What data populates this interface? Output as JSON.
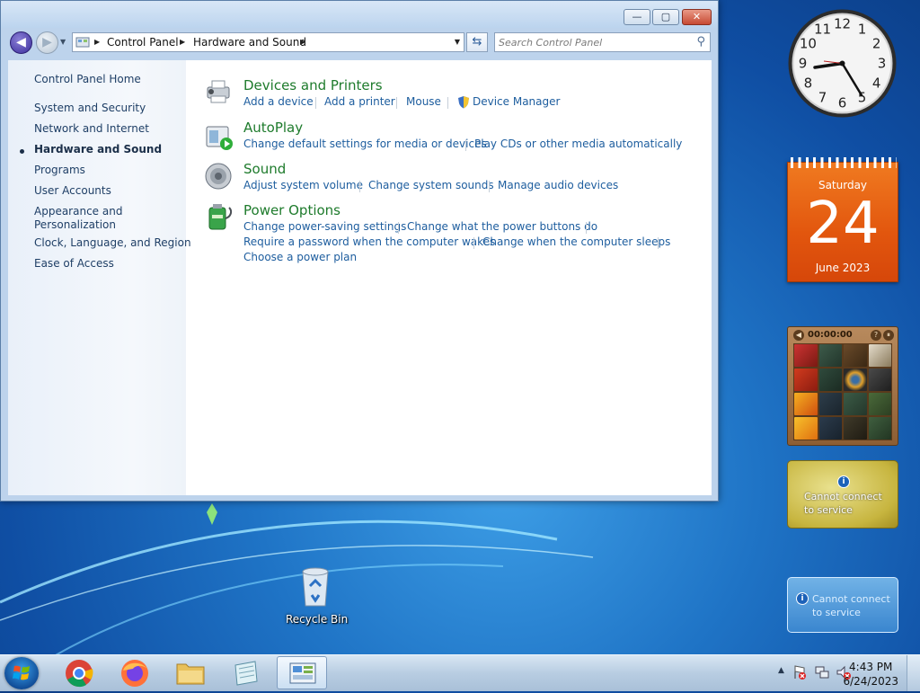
{
  "window": {
    "min_label": "—",
    "max_label": "▢",
    "close_label": "✕"
  },
  "nav": {
    "back_glyph": "◀",
    "forward_glyph": "▶",
    "breadcrumbs": [
      "Control Panel",
      "Hardware and Sound"
    ],
    "search_placeholder": "Search Control Panel"
  },
  "sidebar": {
    "items": [
      {
        "label": "Control Panel Home"
      },
      {
        "label": "System and Security"
      },
      {
        "label": "Network and Internet"
      },
      {
        "label": "Hardware and Sound",
        "current": true
      },
      {
        "label": "Programs"
      },
      {
        "label": "User Accounts"
      },
      {
        "label": "Appearance and Personalization"
      },
      {
        "label": "Clock, Language, and Region"
      },
      {
        "label": "Ease of Access"
      }
    ],
    "appearance_line1": "Appearance and",
    "appearance_line2": "Personalization"
  },
  "categories": {
    "devices": {
      "title": "Devices and Printers",
      "links": [
        "Add a device",
        "Add a printer",
        "Mouse",
        "Device Manager"
      ]
    },
    "autoplay": {
      "title": "AutoPlay",
      "links": [
        "Change default settings for media or devices",
        "Play CDs or other media automatically"
      ]
    },
    "sound": {
      "title": "Sound",
      "links": [
        "Adjust system volume",
        "Change system sounds",
        "Manage audio devices"
      ]
    },
    "power": {
      "title": "Power Options",
      "links": [
        "Change power-saving settings",
        "Change what the power buttons do",
        "Require a password when the computer wakes",
        "Change when the computer sleeps",
        "Choose a power plan"
      ]
    }
  },
  "gadgets": {
    "clock_numbers": [
      "12",
      "1",
      "2",
      "3",
      "4",
      "5",
      "6",
      "7",
      "8",
      "9",
      "10",
      "11"
    ],
    "calendar": {
      "weekday": "Saturday",
      "day": "24",
      "month_year": "June 2023"
    },
    "puzzle": {
      "timer": "00:00:00",
      "help": "?",
      "pause": "⏸",
      "back": "◀"
    },
    "weather": {
      "line1": "Cannot connect",
      "line2": "to service",
      "info": "i"
    },
    "currency": {
      "line1": "Cannot connect",
      "line2": "to service",
      "info": "i"
    }
  },
  "desktop": {
    "recycle_bin": "Recycle Bin"
  },
  "taskbar": {
    "time": "4:43 PM",
    "date": "6/24/2023",
    "tray_arrow": "▲"
  },
  "icons": [
    "control-panel-icon",
    "search-icon",
    "refresh-icon",
    "printer-icon",
    "autoplay-icon",
    "speaker-icon",
    "power-icon",
    "shield-icon",
    "chrome-icon",
    "firefox-icon",
    "folder-icon",
    "notepad-icon",
    "windows-logo-icon",
    "network-icon",
    "volume-muted-icon",
    "flag-icon",
    "recycle-bin-icon"
  ]
}
